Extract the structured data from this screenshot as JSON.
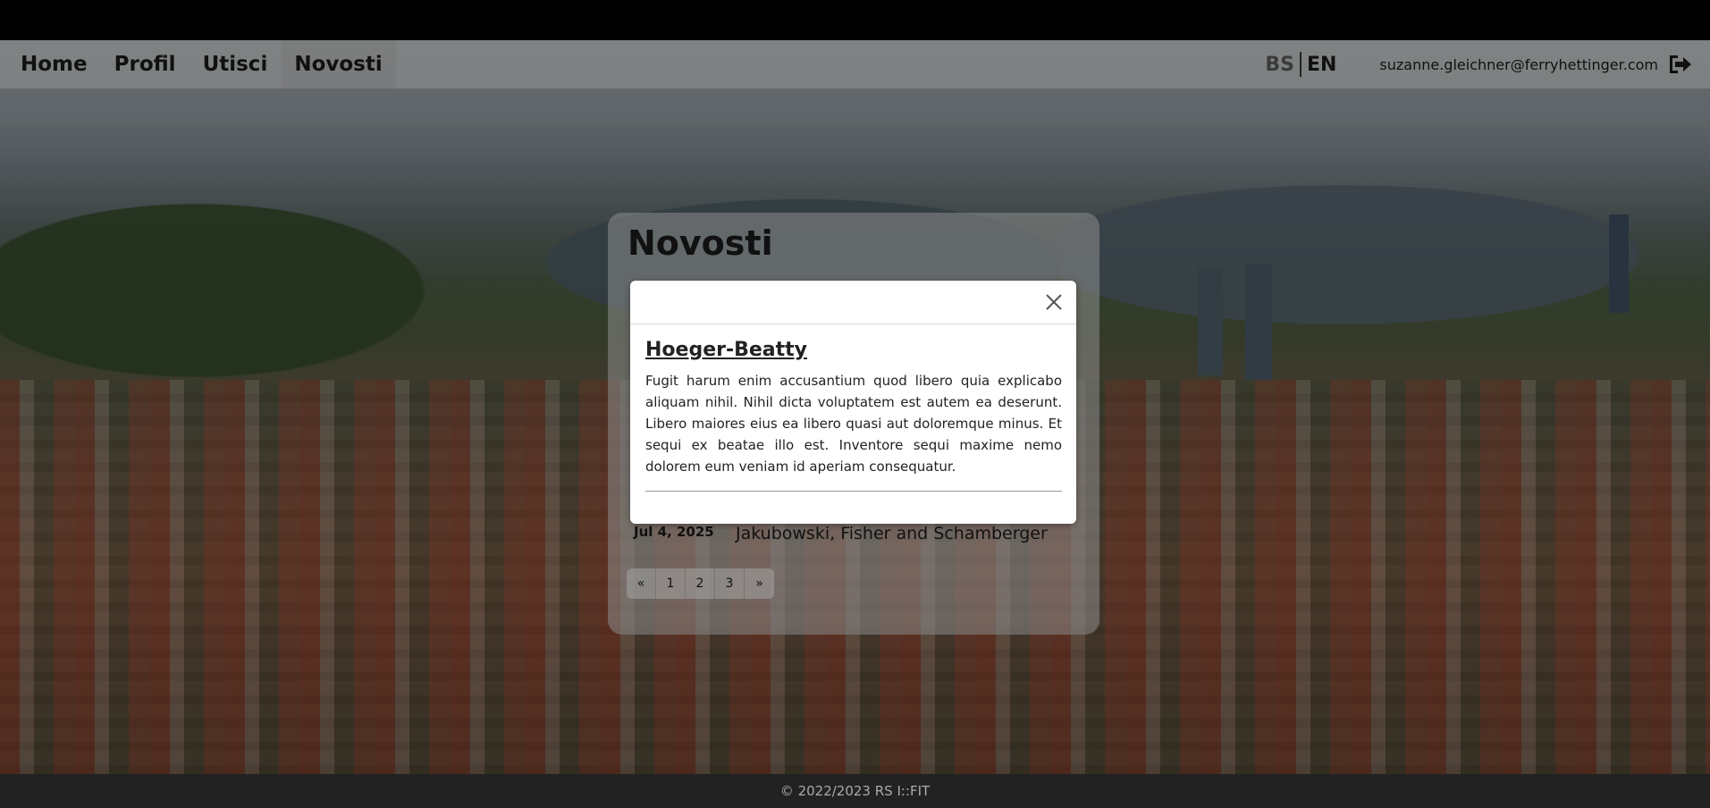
{
  "nav": {
    "links": [
      {
        "label": "Home"
      },
      {
        "label": "Profil"
      },
      {
        "label": "Utisci"
      },
      {
        "label": "Novosti"
      }
    ],
    "active_index": 3,
    "lang_bs": "BS",
    "lang_en": "EN",
    "user_email": "suzanne.gleichner@ferryhettinger.com",
    "logout_icon": "logout-icon"
  },
  "panel": {
    "title": "Novosti",
    "news_item": {
      "date": "Jul 4, 2025",
      "title": "Jakubowski, Fisher and Schamberger"
    },
    "pagination": [
      "«",
      "1",
      "2",
      "3",
      "»"
    ]
  },
  "modal": {
    "title": "Hoeger-Beatty",
    "body": "Fugit harum enim accusantium quod libero quia explicabo aliquam nihil. Nihil dicta voluptatem est autem ea deserunt. Libero maiores eius ea libero quasi aut doloremque minus. Et sequi ex beatae illo est. Inventore sequi maxime nemo dolorem eum veniam id aperiam consequatur.",
    "close_icon": "close-icon"
  },
  "footer": {
    "text": "© 2022/2023 RS I::FIT"
  }
}
